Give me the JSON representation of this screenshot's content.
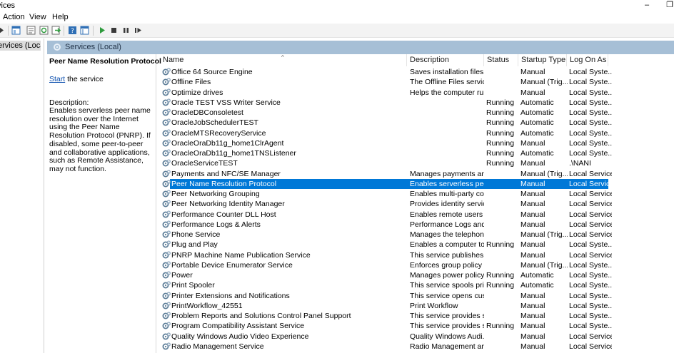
{
  "window": {
    "title": "vices",
    "minimize_glyph": "–",
    "restore_glyph": "❐"
  },
  "menu": {
    "action": "Action",
    "view": "View",
    "help": "Help"
  },
  "toolbar": {
    "icons": [
      "back-arrow-icon",
      "console-tree-icon",
      "properties-icon",
      "refresh-icon",
      "export-icon",
      "help-icon",
      "mmc-view-icon",
      "start-icon",
      "stop-icon",
      "pause-icon",
      "restart-icon"
    ]
  },
  "tree": {
    "selected_node": "ervices (Local)"
  },
  "panel": {
    "header_label": "Services (Local)"
  },
  "detail": {
    "service_title": "Peer Name Resolution Protocol",
    "start_link": "Start",
    "start_suffix": " the service",
    "description_label": "Description:",
    "description_text": "Enables serverless peer name resolution over the Internet using the Peer Name Resolution Protocol (PNRP). If disabled, some peer-to-peer and collaborative applications, such as Remote Assistance, may not function."
  },
  "columns": {
    "name": "Name",
    "description": "Description",
    "status": "Status",
    "startup_type": "Startup Type",
    "log_on_as": "Log On As"
  },
  "services": [
    {
      "name": "Office 64 Source Engine",
      "description": "Saves installation files ...",
      "status": "",
      "startup": "Manual",
      "logon": "Local Syste..."
    },
    {
      "name": "Offline Files",
      "description": "The Offline Files servic...",
      "status": "",
      "startup": "Manual (Trig...",
      "logon": "Local Syste..."
    },
    {
      "name": "Optimize drives",
      "description": "Helps the computer ru...",
      "status": "",
      "startup": "Manual",
      "logon": "Local Syste..."
    },
    {
      "name": "Oracle TEST VSS Writer Service",
      "description": "",
      "status": "Running",
      "startup": "Automatic",
      "logon": "Local Syste..."
    },
    {
      "name": "OracleDBConsoletest",
      "description": "",
      "status": "Running",
      "startup": "Automatic",
      "logon": "Local Syste..."
    },
    {
      "name": "OracleJobSchedulerTEST",
      "description": "",
      "status": "Running",
      "startup": "Automatic",
      "logon": "Local Syste..."
    },
    {
      "name": "OracleMTSRecoveryService",
      "description": "",
      "status": "Running",
      "startup": "Automatic",
      "logon": "Local Syste..."
    },
    {
      "name": "OracleOraDb11g_home1ClrAgent",
      "description": "",
      "status": "Running",
      "startup": "Manual",
      "logon": "Local Syste..."
    },
    {
      "name": "OracleOraDb11g_home1TNSListener",
      "description": "",
      "status": "Running",
      "startup": "Automatic",
      "logon": "Local Syste..."
    },
    {
      "name": "OracleServiceTEST",
      "description": "",
      "status": "Running",
      "startup": "Manual",
      "logon": ".\\NANI"
    },
    {
      "name": "Payments and NFC/SE Manager",
      "description": "Manages payments an...",
      "status": "",
      "startup": "Manual (Trig...",
      "logon": "Local Service"
    },
    {
      "name": "Peer Name Resolution Protocol",
      "description": "Enables serverless peer ...",
      "status": "",
      "startup": "Manual",
      "logon": "Local Service",
      "selected": true
    },
    {
      "name": "Peer Networking Grouping",
      "description": "Enables multi-party co...",
      "status": "",
      "startup": "Manual",
      "logon": "Local Service"
    },
    {
      "name": "Peer Networking Identity Manager",
      "description": "Provides identity servic...",
      "status": "",
      "startup": "Manual",
      "logon": "Local Service"
    },
    {
      "name": "Performance Counter DLL Host",
      "description": "Enables remote users a...",
      "status": "",
      "startup": "Manual",
      "logon": "Local Service"
    },
    {
      "name": "Performance Logs & Alerts",
      "description": "Performance Logs and ...",
      "status": "",
      "startup": "Manual",
      "logon": "Local Service"
    },
    {
      "name": "Phone Service",
      "description": "Manages the telephon...",
      "status": "",
      "startup": "Manual (Trig...",
      "logon": "Local Service"
    },
    {
      "name": "Plug and Play",
      "description": "Enables a computer to ...",
      "status": "Running",
      "startup": "Manual",
      "logon": "Local Syste..."
    },
    {
      "name": "PNRP Machine Name Publication Service",
      "description": "This service publishes a...",
      "status": "",
      "startup": "Manual",
      "logon": "Local Service"
    },
    {
      "name": "Portable Device Enumerator Service",
      "description": "Enforces group policy f...",
      "status": "",
      "startup": "Manual (Trig...",
      "logon": "Local Syste..."
    },
    {
      "name": "Power",
      "description": "Manages power policy ...",
      "status": "Running",
      "startup": "Automatic",
      "logon": "Local Syste..."
    },
    {
      "name": "Print Spooler",
      "description": "This service spools prin...",
      "status": "Running",
      "startup": "Automatic",
      "logon": "Local Syste..."
    },
    {
      "name": "Printer Extensions and Notifications",
      "description": "This service opens cust...",
      "status": "",
      "startup": "Manual",
      "logon": "Local Syste..."
    },
    {
      "name": "PrintWorkflow_42551",
      "description": "Print Workflow",
      "status": "",
      "startup": "Manual",
      "logon": "Local Syste..."
    },
    {
      "name": "Problem Reports and Solutions Control Panel Support",
      "description": "This service provides s...",
      "status": "",
      "startup": "Manual",
      "logon": "Local Syste..."
    },
    {
      "name": "Program Compatibility Assistant Service",
      "description": "This service provides s...",
      "status": "Running",
      "startup": "Manual",
      "logon": "Local Syste..."
    },
    {
      "name": "Quality Windows Audio Video Experience",
      "description": "Quality Windows Audi...",
      "status": "",
      "startup": "Manual",
      "logon": "Local Service"
    },
    {
      "name": "Radio Management Service",
      "description": "Radio Management an...",
      "status": "",
      "startup": "Manual",
      "logon": "Local Service"
    }
  ]
}
